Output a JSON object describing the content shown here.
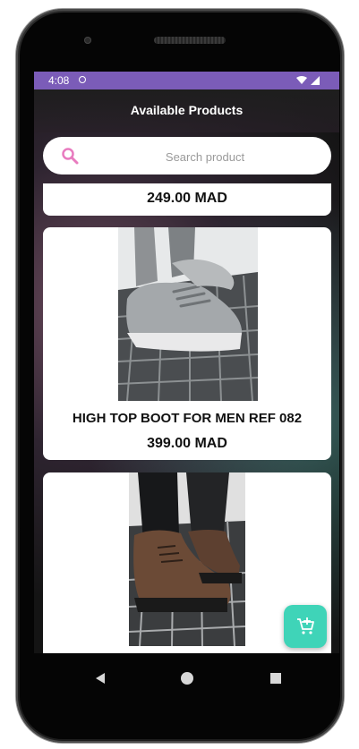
{
  "status_bar": {
    "time": "4:08"
  },
  "app_bar": {
    "title": "Available Products"
  },
  "search": {
    "placeholder": "Search product"
  },
  "products": [
    {
      "price": "249.00 MAD"
    },
    {
      "name": "HIGH TOP BOOT FOR MEN REF 082",
      "price": "399.00 MAD"
    },
    {
      "name": "",
      "price": ""
    }
  ],
  "fab": {
    "icon": "add-to-cart-icon"
  },
  "colors": {
    "status_bar": "#7b5cb8",
    "fab": "#3fd4b8",
    "search_icon": "#e87bbf"
  },
  "nav": {
    "icons": [
      "back-icon",
      "home-icon",
      "recents-icon"
    ]
  }
}
